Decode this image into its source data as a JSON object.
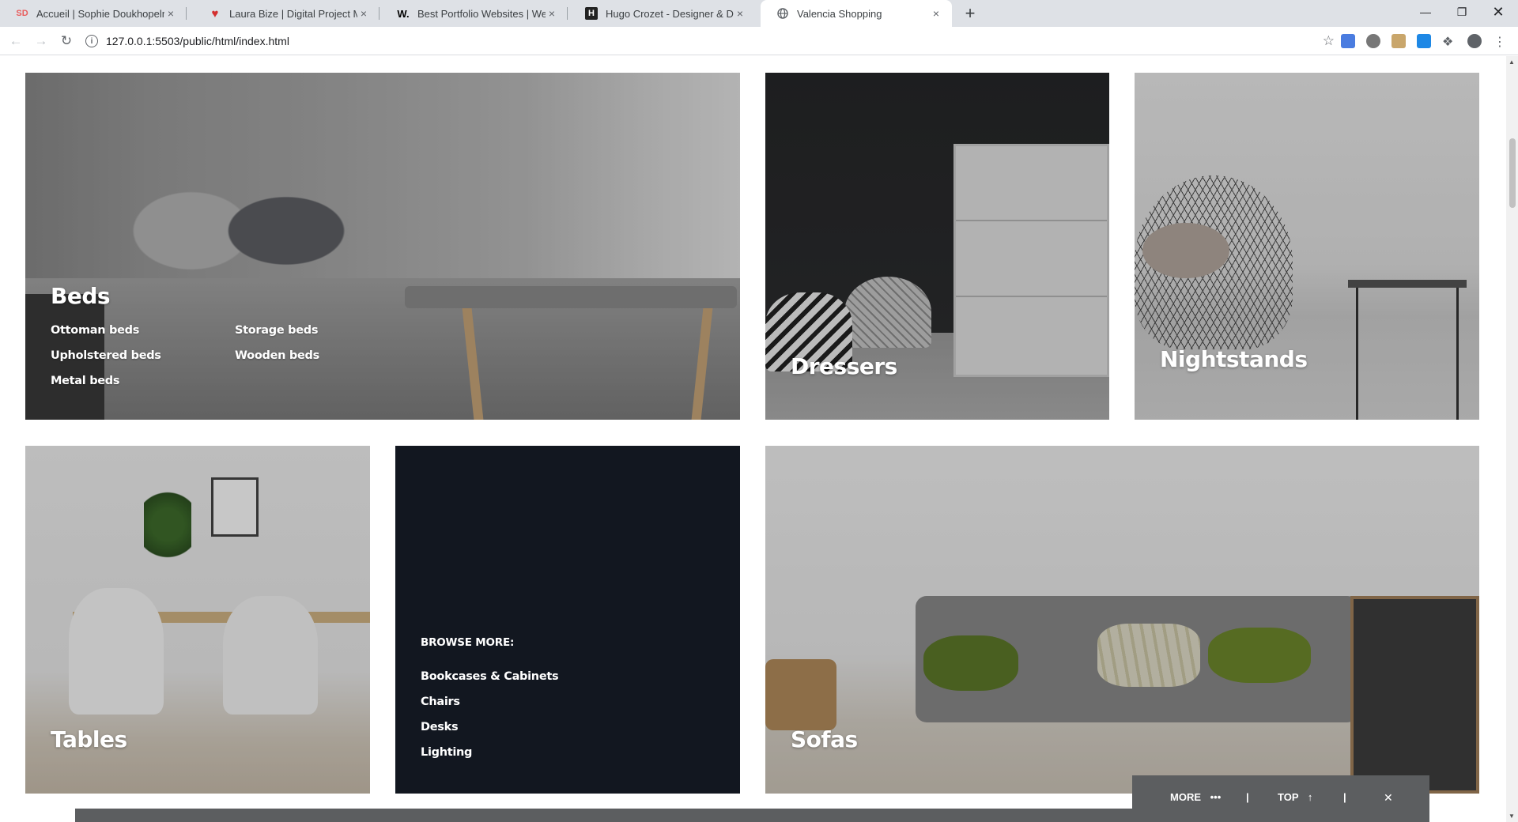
{
  "browser": {
    "tabs": [
      {
        "title": "Accueil | Sophie Doukhopelnikoff",
        "favicon": "SD"
      },
      {
        "title": "Laura Bize | Digital Project Manager",
        "favicon": "♥"
      },
      {
        "title": "Best Portfolio Websites | Web Design",
        "favicon": "W."
      },
      {
        "title": "Hugo Crozet - Designer & Developer",
        "favicon": "H"
      },
      {
        "title": "Valencia Shopping",
        "favicon": "globe-icon"
      }
    ],
    "active_tab": 4,
    "url": "127.0.0.1:5503/public/html/index.html",
    "new_tab_label": "+",
    "close_glyph": "×"
  },
  "categories": {
    "beds": {
      "title": "Beds",
      "links": [
        "Ottoman beds",
        "Upholstered beds",
        "Metal beds",
        "Storage beds",
        "Wooden beds"
      ]
    },
    "dressers": {
      "title": "Dressers"
    },
    "nightstands": {
      "title": "Nightstands"
    },
    "tables": {
      "title": "Tables"
    },
    "sofas": {
      "title": "Sofas"
    }
  },
  "browse_more": {
    "heading": "BROWSE MORE:",
    "links": [
      "Bookcases & Cabinets",
      "Chairs",
      "Desks",
      "Lighting"
    ]
  },
  "floating_bar": {
    "more_label": "MORE",
    "more_icon": "•••",
    "top_label": "TOP",
    "top_icon": "↑",
    "separator": "|",
    "close_icon": "✕"
  },
  "colors": {
    "browse_bg": "#121720",
    "floating_bar_bg": "#5c5e60"
  }
}
